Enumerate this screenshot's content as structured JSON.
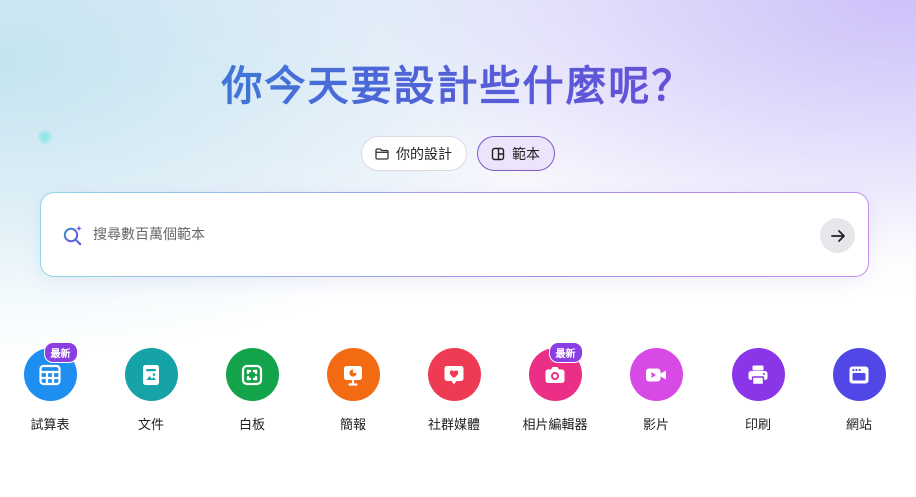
{
  "title": "你今天要設計些什麼呢？",
  "tabs": [
    {
      "label": "你的設計",
      "icon": "folder-icon",
      "active": false
    },
    {
      "label": "範本",
      "icon": "template-icon",
      "active": true
    }
  ],
  "search": {
    "placeholder": "搜尋數百萬個範本",
    "value": "",
    "icon": "magic-search-icon",
    "submit_icon": "arrow-right-icon"
  },
  "categories": [
    {
      "label": "試算表",
      "icon": "spreadsheet-icon",
      "color": "#1e8ff0",
      "badge": "最新"
    },
    {
      "label": "文件",
      "icon": "document-icon",
      "color": "#16a3a8",
      "badge": ""
    },
    {
      "label": "白板",
      "icon": "whiteboard-icon",
      "color": "#13a34a",
      "badge": ""
    },
    {
      "label": "簡報",
      "icon": "presentation-icon",
      "color": "#f26a12",
      "badge": ""
    },
    {
      "label": "社群媒體",
      "icon": "heart-chat-icon",
      "color": "#ee3a52",
      "badge": ""
    },
    {
      "label": "相片編輯器",
      "icon": "camera-icon",
      "color": "#ec2f86",
      "badge": "最新"
    },
    {
      "label": "影片",
      "icon": "video-icon",
      "color": "#d84ae6",
      "badge": ""
    },
    {
      "label": "印刷",
      "icon": "printer-icon",
      "color": "#8a35e8",
      "badge": ""
    },
    {
      "label": "網站",
      "icon": "website-icon",
      "color": "#5047e6",
      "badge": ""
    }
  ]
}
